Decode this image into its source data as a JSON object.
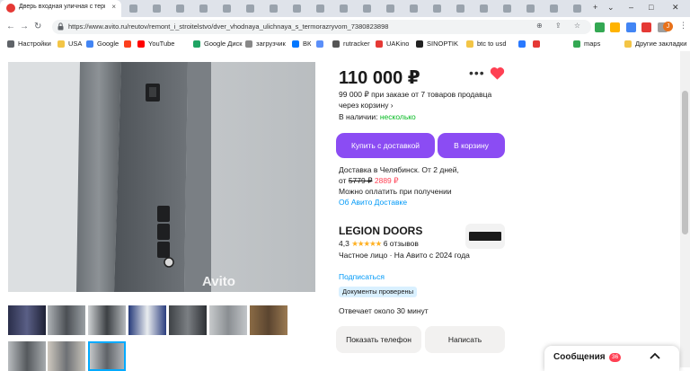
{
  "browser": {
    "active_tab_title": "Дверь входная уличная с термор",
    "url": "https://www.avito.ru/reutov/remont_i_stroitelstvo/dver_vhodnaya_ulichnaya_s_termorazryvom_7380823898",
    "bookmarks": [
      {
        "label": "Настройки",
        "color": "#5f6368"
      },
      {
        "label": "USA",
        "color": "#f3c546"
      },
      {
        "label": "Google",
        "color": "#4285f4"
      },
      {
        "label": "",
        "color": "#fc3f1d"
      },
      {
        "label": "YouTube",
        "color": "#ff0000"
      },
      {
        "label": "Google Диск",
        "color": "#1fa463"
      },
      {
        "label": "загрузчик",
        "color": "#888888"
      },
      {
        "label": "ВК",
        "color": "#0077ff"
      },
      {
        "label": "",
        "color": "#5b8ff9"
      },
      {
        "label": "rutracker",
        "color": "#555555"
      },
      {
        "label": "UAKino",
        "color": "#e53935"
      },
      {
        "label": "SINOPTIK",
        "color": "#222222"
      },
      {
        "label": "btc to usd",
        "color": "#f3c546"
      },
      {
        "label": "",
        "color": "#2979ff"
      },
      {
        "label": "",
        "color": "#e53935"
      },
      {
        "label": "maps",
        "color": "#34a853"
      },
      {
        "label": "Другие закладки",
        "color": "#f3c546"
      }
    ]
  },
  "listing": {
    "price": "110 000 ₽",
    "cart_price": "99 000 ₽ при заказе от 7 товаров продавца через корзину ›",
    "availability_label": "В наличии:",
    "availability_value": "несколько",
    "btn_delivery": "Купить с доставкой",
    "btn_cart": "В корзину",
    "delivery_line1": "Доставка в Челябинск. От 2 дней,",
    "delivery_from": "от",
    "delivery_old_price": "5779 ₽",
    "delivery_new_price": "2889 ₽",
    "delivery_pay": "Можно оплатить при получении",
    "delivery_link": "Об Авито Доставке",
    "photo_watermark": "Avito"
  },
  "seller": {
    "name": "LEGION DOORS",
    "rating_value": "4,3",
    "stars": "★★★★★",
    "reviews": "6 отзывов",
    "type": "Частное лицо · На Авито с 2024 года",
    "subscribe": "Подписаться",
    "verified": "Документы проверены",
    "reply_time": "Отвечает около 30 минут",
    "logo_text": "LEGION"
  },
  "actions": {
    "show_phone": "Показать телефон",
    "write": "Написать"
  },
  "messages": {
    "label": "Сообщения",
    "count": "36"
  },
  "colors": {
    "accent": "#8b4cf3",
    "link": "#0099f7",
    "in_stock": "#02b91f",
    "discount": "#ff4053",
    "heart": "#ff4053"
  }
}
